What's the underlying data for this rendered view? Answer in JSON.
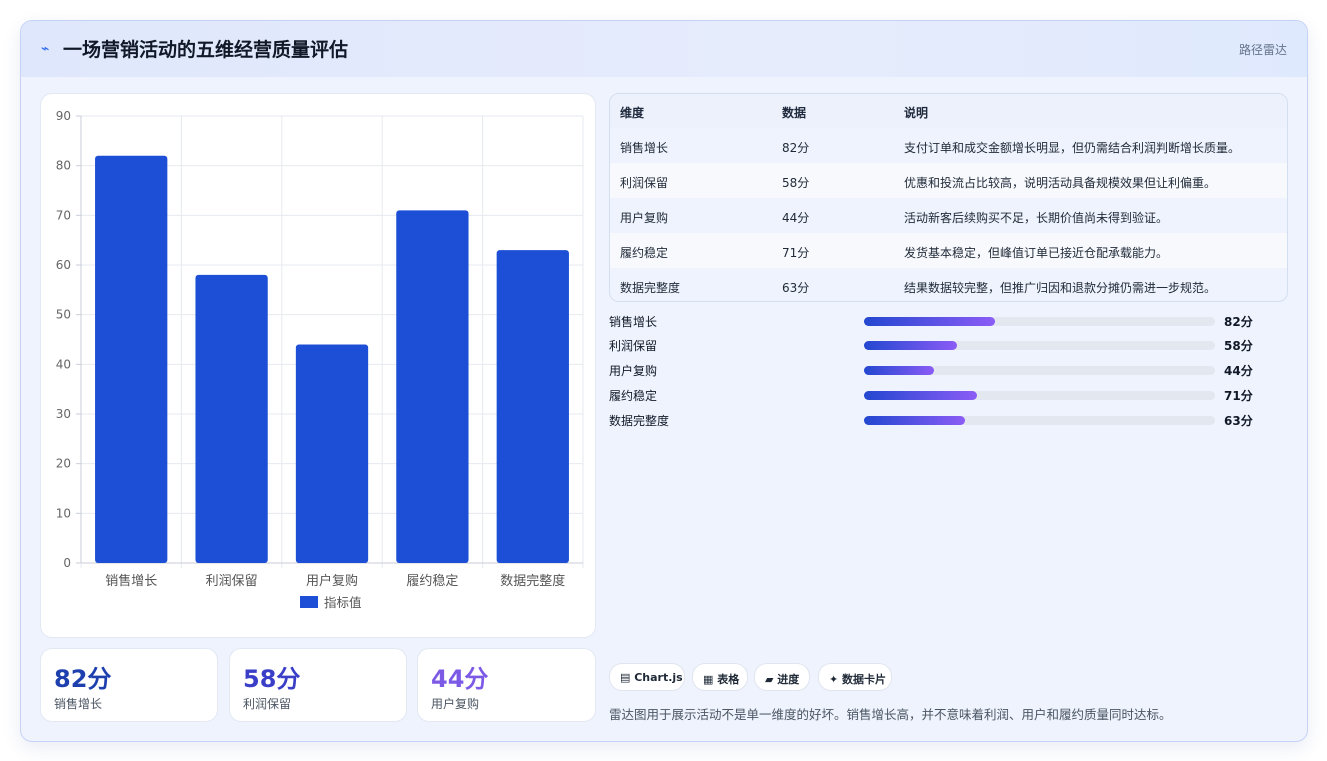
{
  "header": {
    "icon": "⌁",
    "title": "一场营销活动的五维经营质量评估",
    "tag": "路径雷达"
  },
  "chart_data": {
    "type": "bar",
    "categories": [
      "销售增长",
      "利润保留",
      "用户复购",
      "履约稳定",
      "数据完整度"
    ],
    "series": [
      {
        "name": "指标值",
        "values": [
          82,
          58,
          44,
          71,
          63
        ]
      }
    ],
    "ylim": [
      0,
      90
    ],
    "yticks": [
      0,
      10,
      20,
      30,
      40,
      50,
      60,
      70,
      80,
      90
    ],
    "grid": true,
    "legend": "bottom",
    "color": "#1c4fd6"
  },
  "metrics": [
    {
      "value": "82分",
      "label": "销售增长",
      "color": "#1e40af"
    },
    {
      "value": "58分",
      "label": "利润保留",
      "color": "#3b3fc8"
    },
    {
      "value": "44分",
      "label": "用户复购",
      "color": "#7c5ae6"
    }
  ],
  "table": {
    "headers": [
      "维度",
      "数据",
      "说明"
    ],
    "rows": [
      [
        "销售增长",
        "82分",
        "支付订单和成交金额增长明显，但仍需结合利润判断增长质量。"
      ],
      [
        "利润保留",
        "58分",
        "优惠和投流占比较高，说明活动具备规模效果但让利偏重。"
      ],
      [
        "用户复购",
        "44分",
        "活动新客后续购买不足，长期价值尚未得到验证。"
      ],
      [
        "履约稳定",
        "71分",
        "发货基本稳定，但峰值订单已接近仓配承载能力。"
      ],
      [
        "数据完整度",
        "63分",
        "结果数据较完整，但推广归因和退款分摊仍需进一步规范。"
      ]
    ]
  },
  "progress": [
    {
      "label": "销售增长",
      "value": 82,
      "text": "82分"
    },
    {
      "label": "利润保留",
      "value": 58,
      "text": "58分"
    },
    {
      "label": "用户复购",
      "value": 44,
      "text": "44分"
    },
    {
      "label": "履约稳定",
      "value": 71,
      "text": "71分"
    },
    {
      "label": "数据完整度",
      "value": 63,
      "text": "63分"
    }
  ],
  "progress_max": 220,
  "chips": [
    "▤ Chart.js",
    "▦ 表格",
    "▰ 进度",
    "✦ 数据卡片"
  ],
  "note": "雷达图用于展示活动不是单一维度的好坏。销售增长高，并不意味着利润、用户和履约质量同时达标。"
}
